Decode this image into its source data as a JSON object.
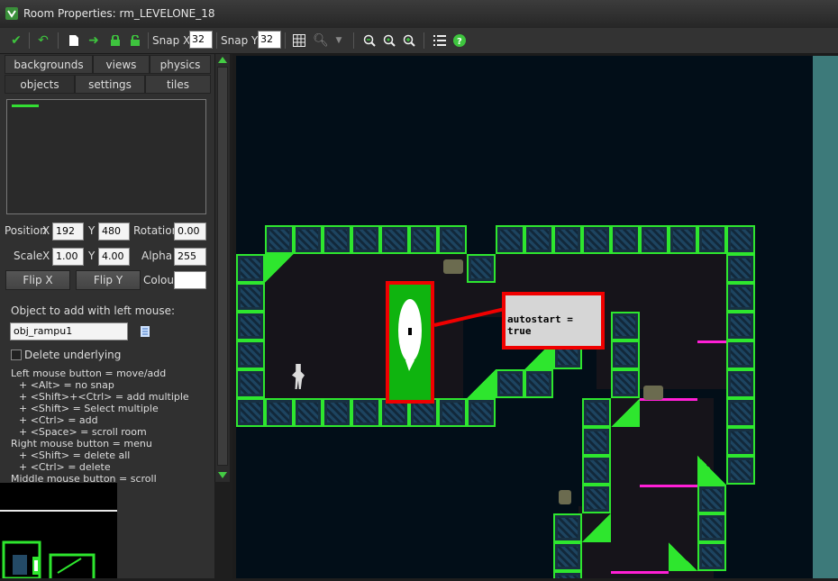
{
  "window": {
    "title": "Room Properties: rm_LEVELONE_18"
  },
  "toolbar": {
    "snap_x_label": "Snap X:",
    "snap_x_value": "32",
    "snap_y_label": "Snap Y:",
    "snap_y_value": "32",
    "icons": [
      "ok-icon",
      "undo-icon",
      "new-icon",
      "next-icon",
      "lock-icon",
      "unlock-icon",
      "grid-icon",
      "magnifier-icon",
      "zoom-out-icon",
      "zoom-reset-icon",
      "zoom-in-icon",
      "list-icon",
      "help-icon"
    ]
  },
  "tabs": {
    "row1": [
      "backgrounds",
      "views",
      "physics"
    ],
    "row2": [
      "objects",
      "settings",
      "tiles"
    ],
    "active": "objects"
  },
  "props": {
    "position_label": "Position",
    "x_label": "X",
    "y_label": "Y",
    "pos_x": "192",
    "pos_y": "480",
    "rotation_label": "Rotation",
    "rotation": "0.00",
    "scale_label": "Scale",
    "scale_x": "1.00",
    "scale_y": "4.00",
    "alpha_label": "Alpha",
    "alpha": "255",
    "flipx": "Flip X",
    "flipy": "Flip Y",
    "colour_label": "Colour",
    "colour_value": "#ffffff"
  },
  "object": {
    "add_label": "Object to add with left mouse:",
    "name": "obj_rampu1",
    "delete_underlying": "Delete underlying"
  },
  "help_lines": [
    "Left mouse button = move/add",
    "+ <Alt> = no snap",
    "+ <Shift>+<Ctrl> = add multiple",
    "+ <Shift> = Select multiple",
    "+ <Ctrl> = add",
    "+ <Space> = scroll room",
    "Right mouse button = menu",
    "+ <Shift> = delete all",
    "+ <Ctrl> = delete",
    "Middle mouse button = scroll"
  ],
  "canvas": {
    "annotation": "autostart = true",
    "colors": {
      "wall": "#2ee62e",
      "selection": "#f00000",
      "platform": "#ff1fd6",
      "background": "#020e18"
    }
  }
}
